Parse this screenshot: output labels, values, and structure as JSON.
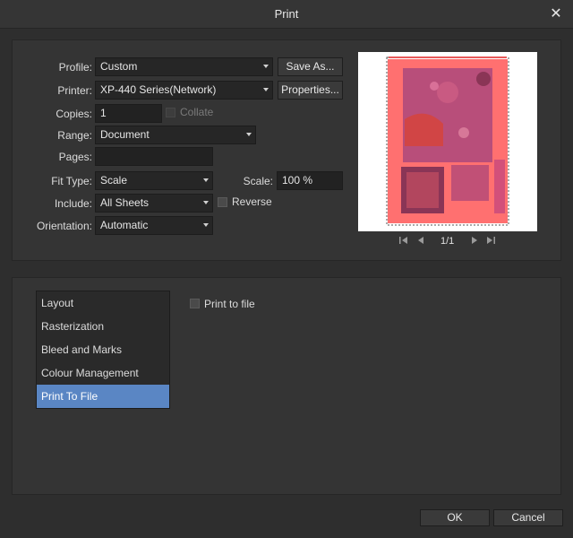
{
  "window": {
    "title": "Print",
    "close_symbol": "✕"
  },
  "form": {
    "profile": {
      "label": "Profile:",
      "value": "Custom"
    },
    "printer": {
      "label": "Printer:",
      "value": "XP-440 Series(Network)"
    },
    "copies": {
      "label": "Copies:",
      "value": "1"
    },
    "collate": {
      "label": "Collate",
      "checked": false,
      "enabled": false
    },
    "range": {
      "label": "Range:",
      "value": "Document"
    },
    "pages": {
      "label": "Pages:",
      "value": ""
    },
    "fit_type": {
      "label": "Fit Type:",
      "value": "Scale"
    },
    "scale": {
      "label": "Scale:",
      "value": "100 %"
    },
    "include": {
      "label": "Include:",
      "value": "All Sheets"
    },
    "reverse": {
      "label": "Reverse",
      "checked": false
    },
    "orientation": {
      "label": "Orientation:",
      "value": "Automatic"
    }
  },
  "buttons": {
    "save_as": "Save As...",
    "properties": "Properties..."
  },
  "preview": {
    "page_indicator": "1/1",
    "nav": {
      "first": "first-page-icon",
      "prev": "prev-page-icon",
      "next": "next-page-icon",
      "last": "last-page-icon"
    }
  },
  "sections": {
    "items": [
      "Layout",
      "Rasterization",
      "Bleed and Marks",
      "Colour Management",
      "Print To File"
    ],
    "selected_index": 4
  },
  "print_to_file": {
    "label": "Print to file",
    "checked": false
  },
  "footer": {
    "ok": "OK",
    "cancel": "Cancel"
  },
  "colors": {
    "accent": "#5a86c4",
    "preview_overlay": "#ff6f6f"
  }
}
